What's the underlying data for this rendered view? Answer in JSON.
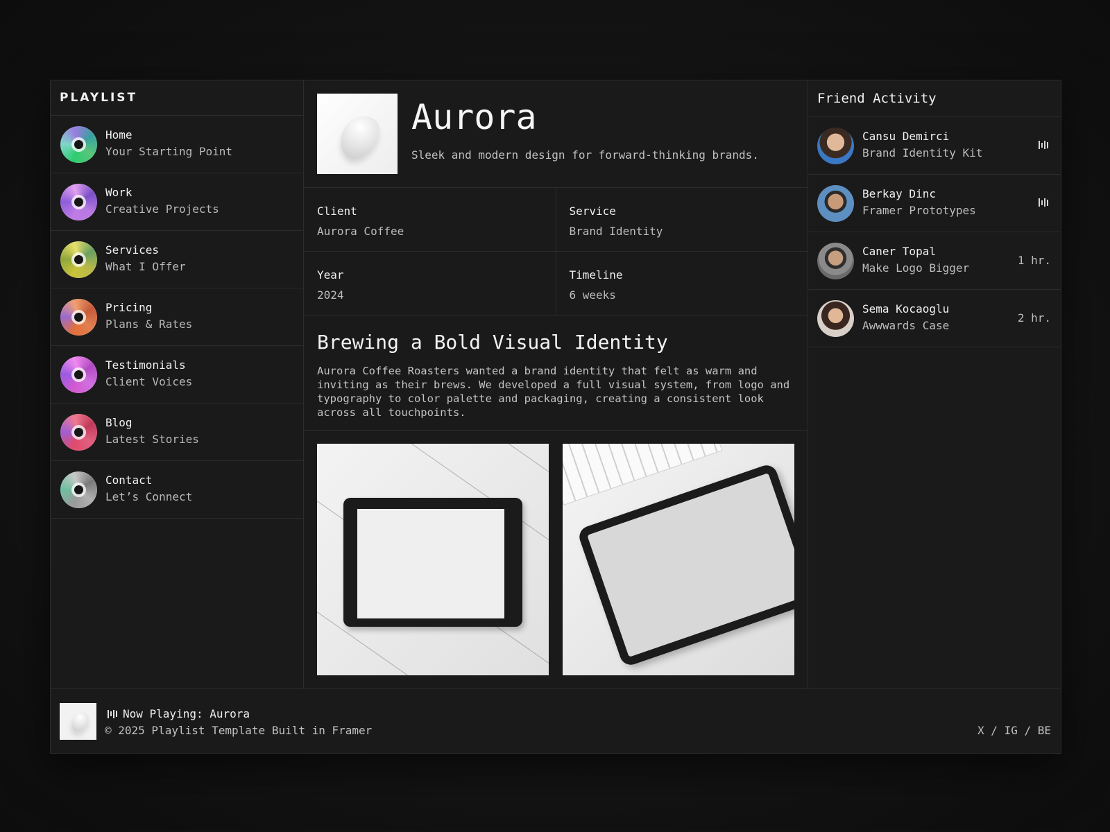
{
  "sidebar": {
    "title": "PLAYLIST",
    "items": [
      {
        "label": "Home",
        "sub": "Your Starting Point"
      },
      {
        "label": "Work",
        "sub": "Creative Projects"
      },
      {
        "label": "Services",
        "sub": "What I Offer"
      },
      {
        "label": "Pricing",
        "sub": "Plans & Rates"
      },
      {
        "label": "Testimonials",
        "sub": "Client Voices"
      },
      {
        "label": "Blog",
        "sub": "Latest Stories"
      },
      {
        "label": "Contact",
        "sub": "Let’s Connect"
      }
    ]
  },
  "project": {
    "title": "Aurora",
    "description": "Sleek and modern design for forward-thinking brands.",
    "meta": {
      "client_label": "Client",
      "client_value": "Aurora Coffee",
      "service_label": "Service",
      "service_value": "Brand Identity",
      "year_label": "Year",
      "year_value": "2024",
      "timeline_label": "Timeline",
      "timeline_value": "6 weeks"
    },
    "article_title": "Brewing a Bold Visual Identity",
    "article_body": "Aurora Coffee Roasters wanted a brand identity that felt as warm and inviting as their brews. We developed a full visual system, from logo and typography to color palette and packaging, creating a consistent look across all touchpoints."
  },
  "friends": {
    "title": "Friend Activity",
    "items": [
      {
        "name": "Cansu Demirci",
        "track": "Brand Identity Kit",
        "status": "playing-icon"
      },
      {
        "name": "Berkay Dinc",
        "track": "Framer Prototypes",
        "status": "playing-icon"
      },
      {
        "name": "Caner Topal",
        "track": "Make Logo Bigger",
        "time": "1 hr."
      },
      {
        "name": "Sema Kocaoglu",
        "track": "Awwwards Case",
        "time": "2 hr."
      }
    ]
  },
  "footer": {
    "now_playing": "Now Playing: Aurora",
    "copyright": "© 2025 Playlist Template Built in Framer",
    "socials": "X / IG / BE"
  },
  "colors": {
    "background": "#141414",
    "panel": "#1a1a1a",
    "border": "#2c2c2c",
    "text": "#f1f1f1",
    "muted": "#bdbdbd"
  }
}
